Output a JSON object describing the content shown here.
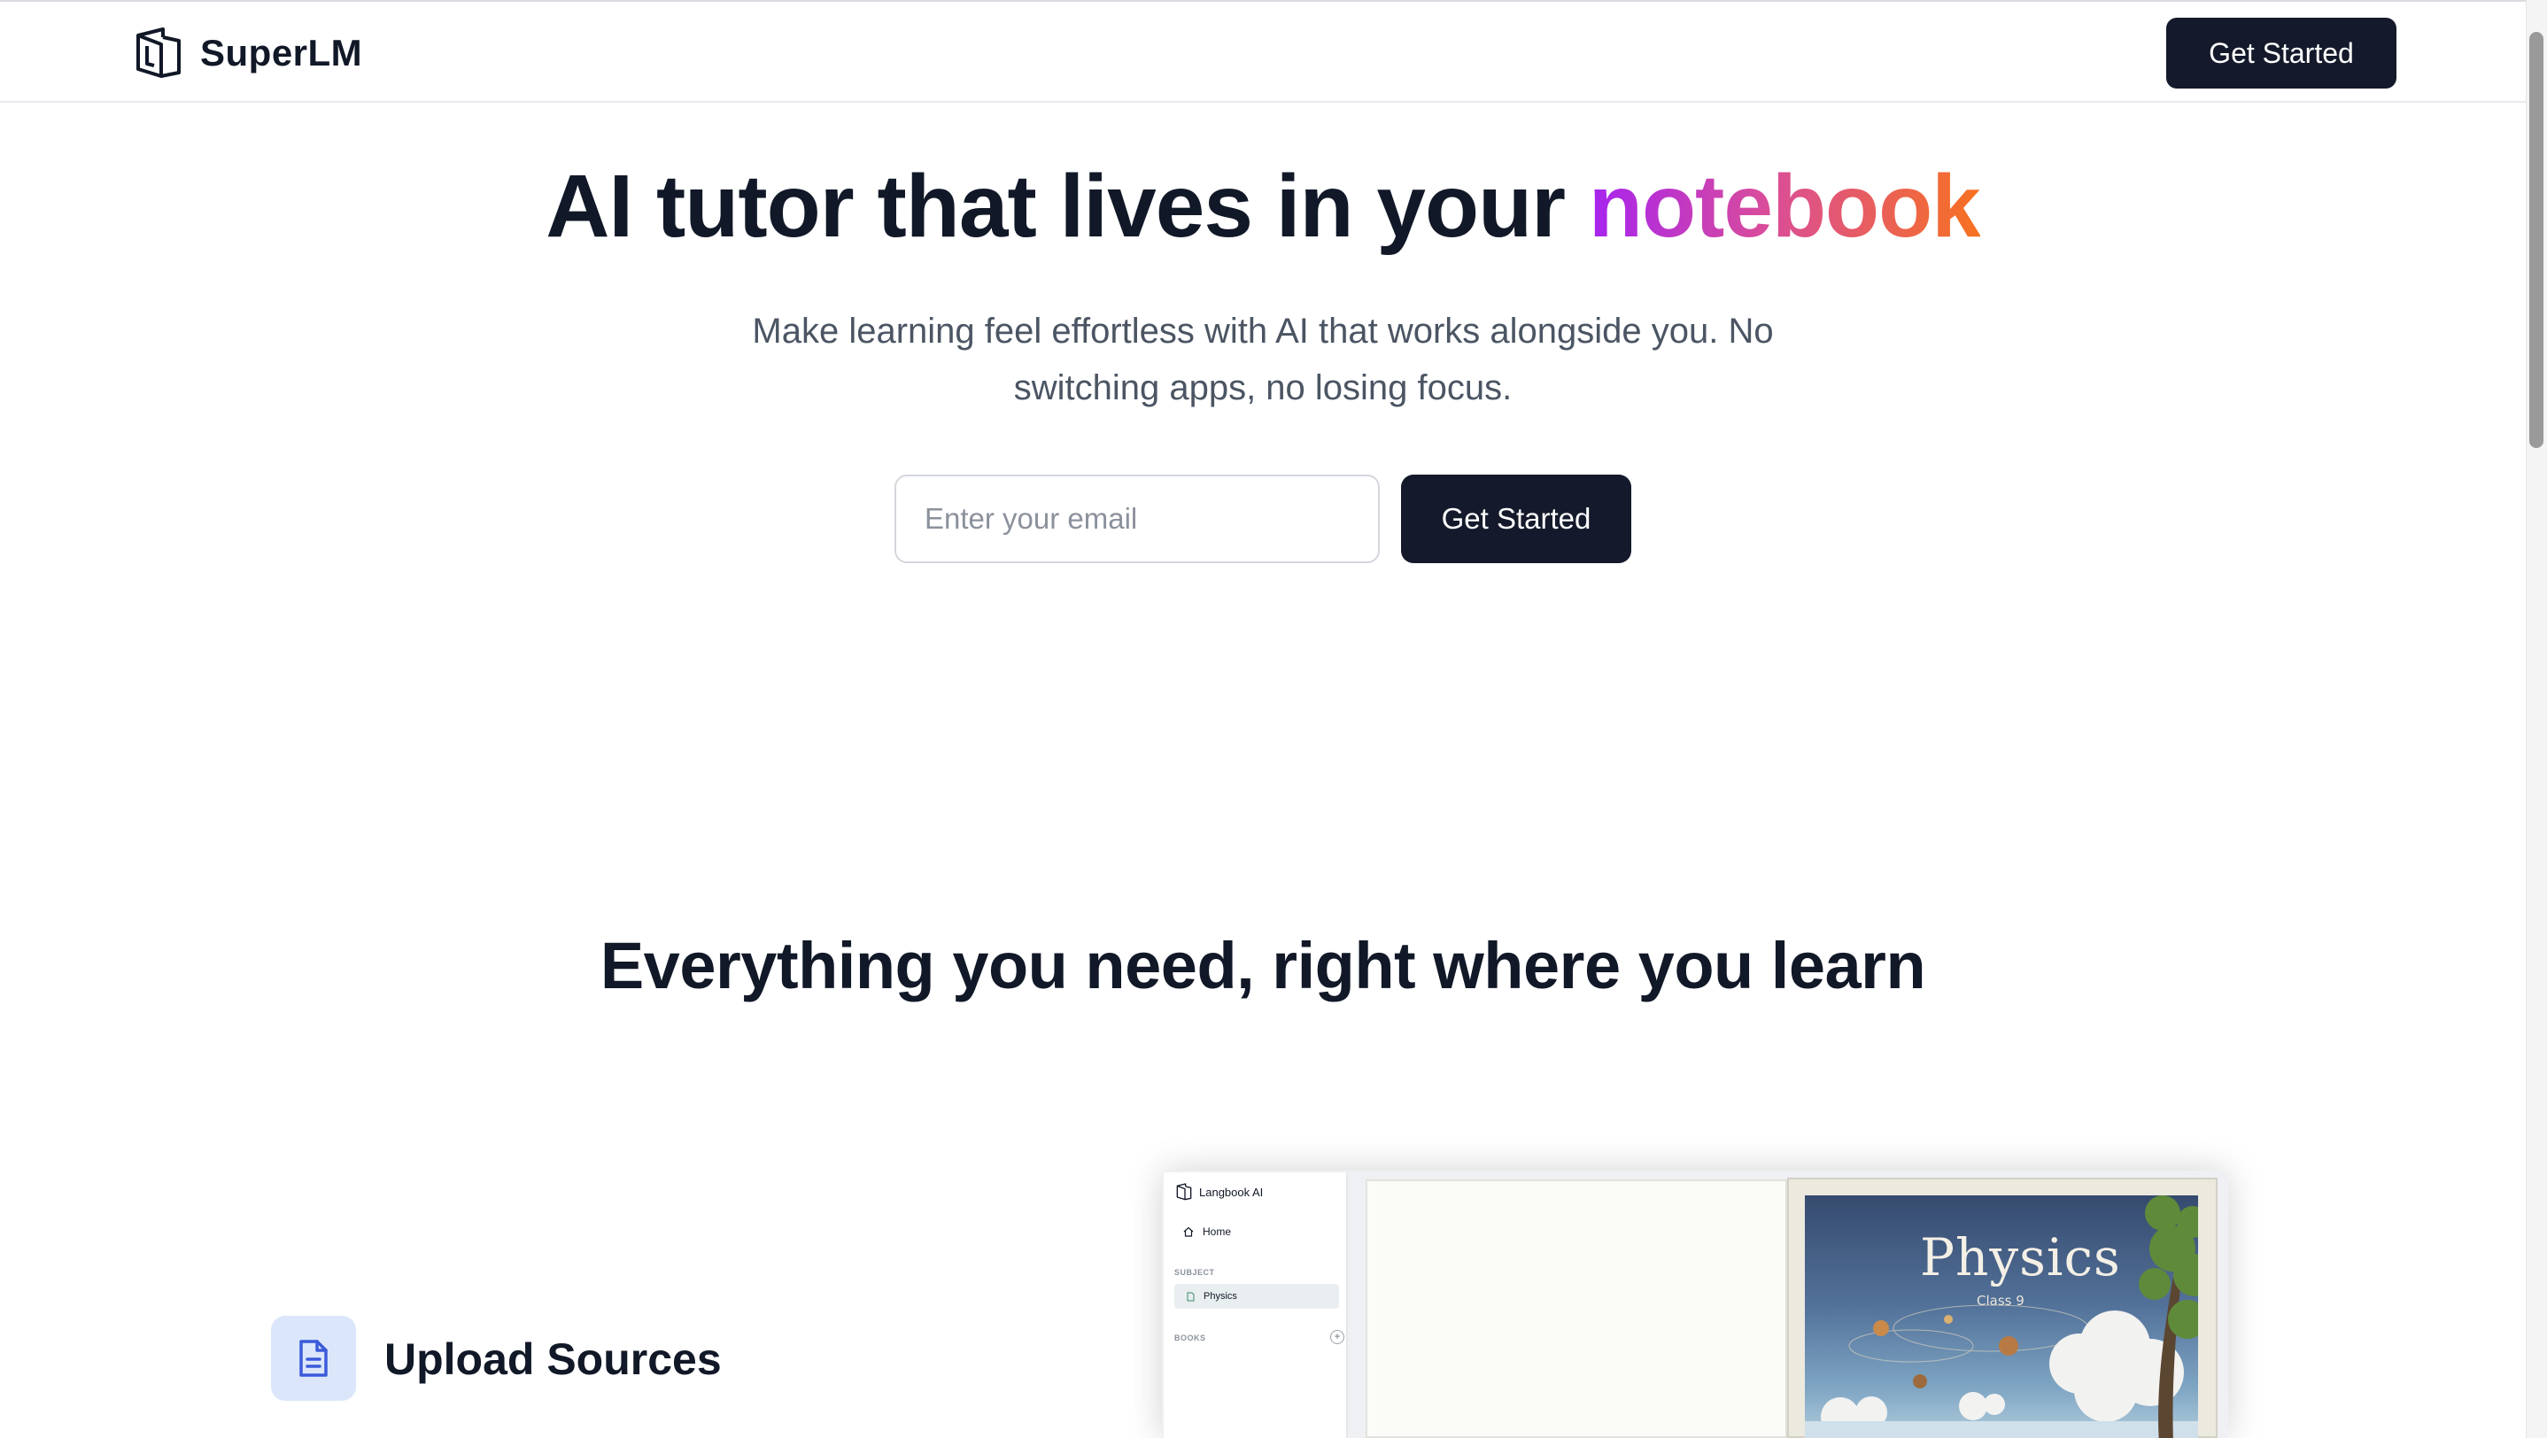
{
  "navbar": {
    "brand_name": "SuperLM",
    "cta_label": "Get Started"
  },
  "hero": {
    "title_prefix": "AI tutor that lives in your ",
    "title_highlight": "notebook",
    "subtitle": "Make learning feel effortless with AI that works alongside you. No switching apps, no losing focus.",
    "email_placeholder": "Enter your email",
    "email_value": "",
    "cta_label": "Get Started"
  },
  "features": {
    "title": "Everything you need, right where you learn",
    "items": [
      {
        "label": "Upload Sources",
        "icon": "document-icon"
      }
    ]
  },
  "preview": {
    "app_name": "Langbook AI",
    "home_label": "Home",
    "subject_section": "SUBJECT",
    "subject_item": "Physics",
    "books_section": "BOOKS",
    "add_symbol": "+",
    "cover_title": "Physics",
    "cover_subtitle": "Class 9"
  },
  "colors": {
    "primary_button": "#141a2b",
    "gradient_start": "#a623f0",
    "gradient_end": "#f7711f",
    "feature_icon_bg": "#dbe6fb",
    "feature_icon": "#3b5bd9"
  }
}
